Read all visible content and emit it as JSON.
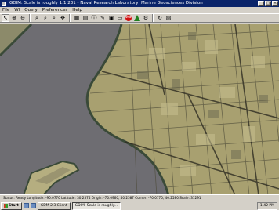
{
  "window": {
    "title": "GDIM: Scale is roughly 1:1,231 - Naval Research Laboratory, Marine Geosciences Division",
    "controls": [
      "_",
      "□",
      "×"
    ]
  },
  "menu": [
    "File",
    "Wl",
    "Query",
    "Preferences",
    "Help"
  ],
  "toolbar": {
    "tools": [
      "pointer-icon",
      "zoom-in-icon",
      "zoom-out-icon",
      "zoom-full-icon",
      "zoom-back-icon",
      "zoom-area-icon",
      "pan-icon",
      "grid-icon",
      "layers-icon",
      "info-icon",
      "measure-icon",
      "print-icon",
      "folder-icon",
      "stop-icon",
      "warning-icon",
      "settings-icon",
      "refresh-icon",
      "map-icon"
    ],
    "stop_label": "STOP"
  },
  "status": {
    "text": "Status: Ready  Longitude: -90.0770  Latitude: 30.2574  Origin: -70.0960, 40.2587  Corner: -70.0770, 40.2580  Scale: 31291"
  },
  "taskbar": {
    "start_label": "Start",
    "tasks": [
      "GDM 2.3 Client",
      "GDIM: Scale is roughly..."
    ],
    "clock": "1:42 PM"
  },
  "map": {
    "water_color": "#6e6d72",
    "land_color": "#a8a070",
    "bank_color": "#3a4a38"
  }
}
